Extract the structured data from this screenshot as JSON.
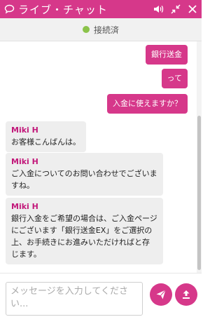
{
  "header": {
    "title": "ライブ・チャット",
    "icons": [
      "chat-bubble-icon",
      "speaker-icon",
      "minimize-icon",
      "close-icon"
    ]
  },
  "status": {
    "text": "接続済",
    "dot_color": "#8bc34a"
  },
  "messages": {
    "outgoing": [
      "銀行送金",
      "って",
      "入金に使えますか？"
    ],
    "incoming": [
      {
        "sender": "Miki H",
        "lines": [
          "お客様こんばんは。"
        ]
      },
      {
        "sender": "Miki H",
        "lines": [
          "ご入金についてのお問い合わせでございま",
          "すね。"
        ]
      },
      {
        "sender": "Miki H",
        "lines": [
          "銀行入金をご希望の場合は、ご入金ページ",
          "にございます「銀行送金EX」をご選択の",
          "上、お手続きにお進みいただければと存",
          "じます。"
        ]
      }
    ]
  },
  "composer": {
    "placeholder": "メッセージを入力してください...",
    "send_icon": "send-icon",
    "upload_icon": "upload-icon"
  },
  "colors": {
    "accent": "#d6388a",
    "sender": "#c2187a",
    "bubble_in": "#eeeeee"
  }
}
